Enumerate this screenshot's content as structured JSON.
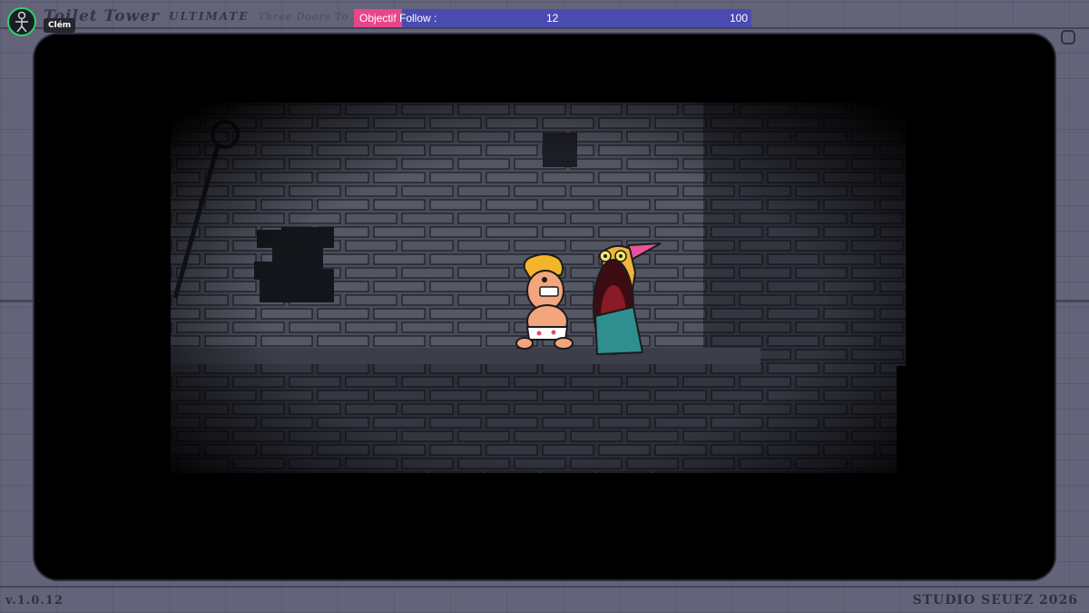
{
  "window": {
    "title_main": "Toilet Tower",
    "title_sub": "ULTIMATE",
    "title_tag": "Three Doors To Destiny"
  },
  "user": {
    "name": "Clém",
    "status_color": "#2bd36a"
  },
  "objective": {
    "label": "Objectif Follow :",
    "current": "12",
    "target": "100",
    "progress_fraction": 0.12,
    "fill_color": "#e8458a",
    "bar_color": "#4a4bb0"
  },
  "game": {
    "characters": [
      {
        "name": "blond-boy-in-underwear"
      },
      {
        "name": "big-mouth-wizard-with-pink-hat"
      }
    ]
  },
  "footer": {
    "version": "v.1.0.12",
    "studio": "STUDIO SEUFZ 2026"
  }
}
